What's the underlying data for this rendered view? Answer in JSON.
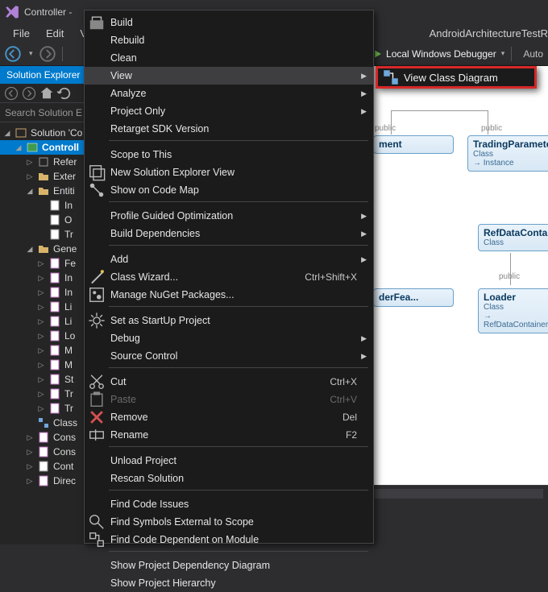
{
  "title": "Controller -",
  "menubar": {
    "file": "File",
    "edit": "Edit",
    "view": "Vie",
    "android": "Android",
    "architecture": "Architecture",
    "test": "Test",
    "r": "R"
  },
  "toolbar": {
    "debugger": "Local Windows Debugger",
    "auto": "Auto"
  },
  "solexp": {
    "title": "Solution Explorer",
    "search": "Search Solution E",
    "items": {
      "root": "Solution 'Co",
      "proj": "Controll",
      "refs": "Refer",
      "ext": "Exter",
      "entities": "Entiti",
      "obj": "O",
      "in": "In",
      "tr": "Tr",
      "gen": "Gene",
      "fe": "Fe",
      "in2": "In",
      "li": "Li",
      "li2": "Li",
      "lo": "Lo",
      "m": "M",
      "m2": "M",
      "st": "St",
      "tr2": "Tr",
      "tr3": "Tr",
      "class": "Class",
      "cons1": "Cons",
      "cons2": "Cons",
      "cont": "Cont",
      "direc": "Direc"
    }
  },
  "diagram": {
    "tradingParam": {
      "name": "TradingParameter",
      "sub": "Class",
      "extra": "→ Instance"
    },
    "refData": {
      "name": "RefDataContainer",
      "sub": "Class"
    },
    "loader": {
      "name": "Loader",
      "sub": "Class",
      "extra": "→ RefDataContainer"
    },
    "partial1": {
      "name": "ment",
      "sub": ""
    },
    "partial2": {
      "name": "derFea...",
      "sub": ""
    },
    "publicLabel1": "public",
    "publicLabel2": "public",
    "publicLabel3": "public"
  },
  "context": [
    {
      "text": "Build",
      "icon": "build",
      "sep": false
    },
    {
      "text": "Rebuild",
      "icon": "",
      "sep": false
    },
    {
      "text": "Clean",
      "icon": "",
      "sep": false
    },
    {
      "text": "View",
      "icon": "",
      "sep": false,
      "sub": true,
      "hl": true
    },
    {
      "text": "Analyze",
      "icon": "",
      "sep": false,
      "sub": true
    },
    {
      "text": "Project Only",
      "icon": "",
      "sep": false,
      "sub": true
    },
    {
      "text": "Retarget SDK Version",
      "icon": "",
      "sep": false
    },
    {
      "sep": true
    },
    {
      "text": "Scope to This",
      "icon": "",
      "sep": false
    },
    {
      "text": "New Solution Explorer View",
      "icon": "newview",
      "sep": false
    },
    {
      "text": "Show on Code Map",
      "icon": "codemap",
      "sep": false
    },
    {
      "sep": true
    },
    {
      "text": "Profile Guided Optimization",
      "icon": "",
      "sep": false,
      "sub": true
    },
    {
      "text": "Build Dependencies",
      "icon": "",
      "sep": false,
      "sub": true
    },
    {
      "sep": true
    },
    {
      "text": "Add",
      "icon": "",
      "sep": false,
      "sub": true
    },
    {
      "text": "Class Wizard...",
      "icon": "wizard",
      "sep": false,
      "shortcut": "Ctrl+Shift+X"
    },
    {
      "text": "Manage NuGet Packages...",
      "icon": "nuget",
      "sep": false
    },
    {
      "sep": true
    },
    {
      "text": "Set as StartUp Project",
      "icon": "gear",
      "sep": false
    },
    {
      "text": "Debug",
      "icon": "",
      "sep": false,
      "sub": true
    },
    {
      "text": "Source Control",
      "icon": "",
      "sep": false,
      "sub": true
    },
    {
      "sep": true
    },
    {
      "text": "Cut",
      "icon": "cut",
      "sep": false,
      "shortcut": "Ctrl+X"
    },
    {
      "text": "Paste",
      "icon": "paste",
      "sep": false,
      "shortcut": "Ctrl+V",
      "disabled": true
    },
    {
      "text": "Remove",
      "icon": "remove",
      "sep": false,
      "shortcut": "Del"
    },
    {
      "text": "Rename",
      "icon": "rename",
      "sep": false,
      "shortcut": "F2"
    },
    {
      "sep": true
    },
    {
      "text": "Unload Project",
      "icon": "",
      "sep": false
    },
    {
      "text": "Rescan Solution",
      "icon": "",
      "sep": false
    },
    {
      "sep": true
    },
    {
      "text": "Find Code Issues",
      "icon": "",
      "sep": false
    },
    {
      "text": "Find Symbols External to Scope",
      "icon": "findsym",
      "sep": false
    },
    {
      "text": "Find Code Dependent on Module",
      "icon": "finddep",
      "sep": false
    },
    {
      "sep": true
    },
    {
      "text": "Show Project Dependency Diagram",
      "icon": "",
      "sep": false
    },
    {
      "text": "Show Project Hierarchy",
      "icon": "",
      "sep": false
    }
  ],
  "flyout": {
    "label": "View Class Diagram"
  },
  "colors": {
    "accent": "#007acc",
    "highlight": "#d72828"
  }
}
